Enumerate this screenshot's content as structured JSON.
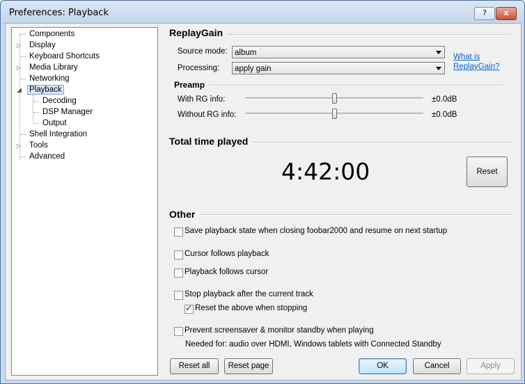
{
  "window": {
    "title": "Preferences: Playback",
    "help_label": "?",
    "close_label": "x"
  },
  "tree": {
    "items": [
      {
        "label": "Components",
        "expandable": false
      },
      {
        "label": "Display",
        "expandable": true
      },
      {
        "label": "Keyboard Shortcuts",
        "expandable": false
      },
      {
        "label": "Media Library",
        "expandable": true
      },
      {
        "label": "Networking",
        "expandable": false
      },
      {
        "label": "Playback",
        "expandable": true,
        "expanded": true,
        "selected": true
      },
      {
        "label": "Decoding",
        "child": true
      },
      {
        "label": "DSP Manager",
        "child": true
      },
      {
        "label": "Output",
        "child": true
      },
      {
        "label": "Shell Integration",
        "expandable": false
      },
      {
        "label": "Tools",
        "expandable": true
      },
      {
        "label": "Advanced",
        "expandable": false
      }
    ]
  },
  "replaygain": {
    "title": "ReplayGain",
    "source_label": "Source mode:",
    "source_value": "album",
    "processing_label": "Processing:",
    "processing_value": "apply gain",
    "link_line1": "What is",
    "link_line2": "ReplayGain?",
    "preamp": {
      "title": "Preamp",
      "with_label": "With RG info:",
      "with_value": "±0.0dB",
      "without_label": "Without RG info:",
      "without_value": "±0.0dB",
      "with_level": 0.5,
      "without_level": 0.5
    }
  },
  "time": {
    "title": "Total time played",
    "value": "4:42:00",
    "reset_label": "Reset"
  },
  "other": {
    "title": "Other",
    "options": [
      {
        "label": "Save playback state when closing foobar2000 and resume on next startup",
        "checked": false
      },
      {
        "label": "Cursor follows playback",
        "checked": false
      },
      {
        "label": "Playback follows cursor",
        "checked": false
      },
      {
        "label": "Stop playback after the current track",
        "checked": false
      },
      {
        "label": "Reset the above when stopping",
        "checked": true
      },
      {
        "label": "Prevent screensaver & monitor standby when playing",
        "checked": false
      }
    ],
    "note": "Needed for: audio over HDMI, Windows tablets with Connected Standby"
  },
  "buttons": {
    "reset_all": "Reset all",
    "reset_page": "Reset page",
    "ok": "OK",
    "cancel": "Cancel",
    "apply": "Apply"
  }
}
